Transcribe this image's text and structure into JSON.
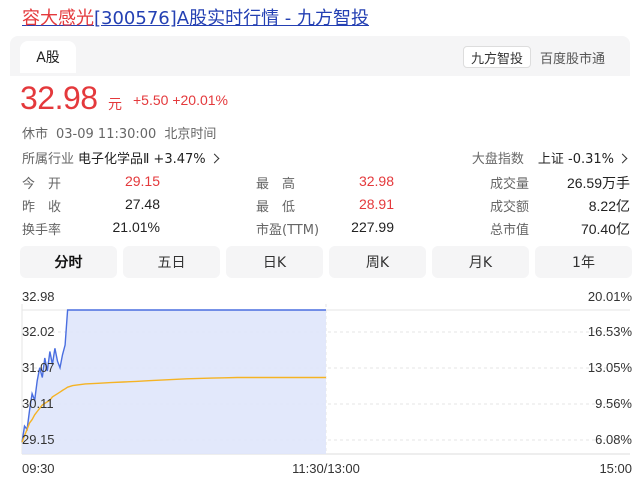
{
  "page": {
    "title_stock": "容大感光",
    "title_rest": "[300576]A股实时行情 - 九方智投"
  },
  "header": {
    "tab_label": "A股",
    "chip_name": "九方智投",
    "chip_source": "百度股市通"
  },
  "quote": {
    "price": "32.98",
    "unit": "元",
    "change": "+5.50",
    "change_pct": "+20.01%"
  },
  "status": {
    "state": "休市",
    "datetime": "03-09 11:30:00",
    "timezone": "北京时间"
  },
  "industry": {
    "label": "所属行业",
    "name": "电子化学品Ⅱ",
    "change": "+3.47%"
  },
  "market_index": {
    "label": "大盘指数",
    "name": "上证",
    "change": "-0.31%"
  },
  "stats": [
    [
      {
        "label": "今　开",
        "value": "29.15",
        "red": true
      },
      {
        "label": "最　高",
        "value": "32.98",
        "red": true
      },
      {
        "label": "成交量",
        "value": "26.59万手",
        "red": false
      }
    ],
    [
      {
        "label": "昨　收",
        "value": "27.48",
        "red": false
      },
      {
        "label": "最　低",
        "value": "28.91",
        "red": true
      },
      {
        "label": "成交额",
        "value": "8.22亿",
        "red": false
      }
    ],
    [
      {
        "label": "换手率",
        "value": "21.01%",
        "red": false
      },
      {
        "label": "市盈(TTM)",
        "value": "227.99",
        "red": false
      },
      {
        "label": "总市值",
        "value": "70.40亿",
        "red": false
      }
    ]
  ],
  "periods": [
    "分时",
    "五日",
    "日K",
    "周K",
    "月K",
    "1年"
  ],
  "active_period": "分时",
  "colors": {
    "up": "#e4393c",
    "price_line": "#4a6ee0",
    "avg_line": "#f5b324",
    "fill": "#dfe6fb"
  },
  "chart_data": {
    "type": "line",
    "y_ticks": [
      "32.98",
      "32.02",
      "31.07",
      "30.11",
      "29.15"
    ],
    "y_right_ticks": [
      "20.01%",
      "16.53%",
      "13.05%",
      "9.56%",
      "6.08%"
    ],
    "x_ticks": [
      "09:30",
      "11:30/13:00",
      "15:00"
    ],
    "ylim": [
      28.54,
      32.98
    ],
    "sessions_total_minutes": 240,
    "series": [
      {
        "values": [
          28.9,
          29.4,
          29.3,
          29.9,
          30.4,
          30.2,
          30.8,
          31.2,
          30.9,
          31.5,
          31.1,
          31.7,
          31.3,
          31.8,
          31.4,
          31.2,
          31.6,
          31.9,
          32.98,
          32.98,
          32.98,
          32.98,
          32.98,
          32.98,
          32.98,
          32.98,
          32.98,
          32.98,
          32.98,
          32.98,
          32.98,
          32.98,
          32.98,
          32.98,
          32.98,
          32.98,
          32.98,
          32.98,
          32.98,
          32.98,
          32.98,
          32.98,
          32.98,
          32.98,
          32.98,
          32.98,
          32.98,
          32.98,
          32.98,
          32.98
        ],
        "x_minutes": [
          0,
          1,
          2,
          3,
          4,
          5,
          6,
          7,
          8,
          9,
          10,
          11,
          12,
          13,
          14,
          15,
          16,
          17,
          18,
          20,
          25,
          30,
          35,
          40,
          45,
          50,
          55,
          60,
          65,
          70,
          75,
          80,
          85,
          90,
          92,
          94,
          96,
          98,
          100,
          102,
          104,
          106,
          108,
          110,
          112,
          114,
          116,
          118,
          119,
          120
        ]
      },
      {
        "values": [
          28.9,
          29.1,
          29.3,
          29.5,
          29.6,
          29.75,
          29.85,
          29.95,
          30.05,
          30.1,
          30.15,
          30.2,
          30.3,
          30.35,
          30.4,
          30.45,
          30.5,
          30.55,
          30.6,
          30.65,
          30.7,
          30.72,
          30.74,
          30.76,
          30.78,
          30.8,
          30.82,
          30.84,
          30.86,
          30.87,
          30.88,
          30.89,
          30.9,
          30.9,
          30.9,
          30.9,
          30.9,
          30.9,
          30.9,
          30.9,
          30.9,
          30.9,
          30.9,
          30.9,
          30.9,
          30.9,
          30.9,
          30.9,
          30.9,
          30.9
        ],
        "x_minutes": [
          0,
          1,
          2,
          3,
          4,
          5,
          6,
          7,
          8,
          9,
          10,
          11,
          12,
          13,
          14,
          15,
          16,
          17,
          18,
          20,
          25,
          30,
          35,
          40,
          45,
          50,
          55,
          60,
          65,
          70,
          75,
          80,
          85,
          90,
          92,
          94,
          96,
          98,
          100,
          102,
          104,
          106,
          108,
          110,
          112,
          114,
          116,
          118,
          119,
          120
        ]
      }
    ]
  }
}
